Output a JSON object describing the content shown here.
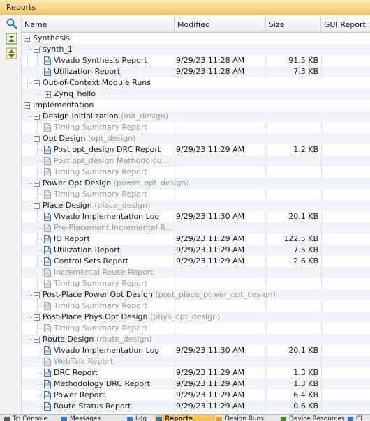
{
  "panel": {
    "title": "Reports"
  },
  "toolbar": {
    "search": "search-icon",
    "collapse_all": "collapse-all-icon",
    "expand_all": "expand-all-icon"
  },
  "columns": {
    "name": "Name",
    "modified": "Modified",
    "size": "Size",
    "gui": "GUI Report"
  },
  "rows": [
    {
      "level": 0,
      "kind": "group",
      "label": "Synthesis"
    },
    {
      "level": 1,
      "kind": "group",
      "label": "synth_1"
    },
    {
      "level": 2,
      "kind": "file",
      "label": "Vivado Synthesis Report",
      "modified": "9/29/23 11:28 AM",
      "size": "91.5 KB"
    },
    {
      "level": 2,
      "kind": "file",
      "label": "Utilization Report",
      "modified": "9/29/23 11:28 AM",
      "size": "7.3 KB"
    },
    {
      "level": 1,
      "kind": "group",
      "label": "Out-of-Context Module Runs"
    },
    {
      "level": 2,
      "kind": "group",
      "collapsed": true,
      "label": "Zynq_hello"
    },
    {
      "level": 0,
      "kind": "group",
      "label": "Implementation"
    },
    {
      "level": 1,
      "kind": "group",
      "label": "Design Initialization",
      "hint": "(init_design)"
    },
    {
      "level": 2,
      "kind": "file",
      "disabled": true,
      "label": "Timing Summary Report"
    },
    {
      "level": 1,
      "kind": "group",
      "label": "Opt Design",
      "hint": "(opt_design)"
    },
    {
      "level": 2,
      "kind": "file",
      "label": "Post opt_design DRC Report",
      "modified": "9/29/23 11:29 AM",
      "size": "1.2 KB"
    },
    {
      "level": 2,
      "kind": "file",
      "disabled": true,
      "label": "Post opt_design Methodolog..."
    },
    {
      "level": 2,
      "kind": "file",
      "disabled": true,
      "label": "Timing Summary Report"
    },
    {
      "level": 1,
      "kind": "group",
      "label": "Power Opt Design",
      "hint": "(power_opt_design)"
    },
    {
      "level": 2,
      "kind": "file",
      "disabled": true,
      "label": "Timing Summary Report"
    },
    {
      "level": 1,
      "kind": "group",
      "label": "Place Design",
      "hint": "(place_design)"
    },
    {
      "level": 2,
      "kind": "file",
      "label": "Vivado Implementation Log",
      "modified": "9/29/23 11:30 AM",
      "size": "20.1 KB"
    },
    {
      "level": 2,
      "kind": "file",
      "disabled": true,
      "label": "Pre-Placement Incremental R..."
    },
    {
      "level": 2,
      "kind": "file",
      "label": "IO Report",
      "modified": "9/29/23 11:29 AM",
      "size": "122.5 KB"
    },
    {
      "level": 2,
      "kind": "file",
      "label": "Utilization Report",
      "modified": "9/29/23 11:29 AM",
      "size": "7.5 KB"
    },
    {
      "level": 2,
      "kind": "file",
      "label": "Control Sets Report",
      "modified": "9/29/23 11:29 AM",
      "size": "2.6 KB"
    },
    {
      "level": 2,
      "kind": "file",
      "disabled": true,
      "label": "Incremental Reuse Report"
    },
    {
      "level": 2,
      "kind": "file",
      "disabled": true,
      "label": "Timing Summary Report"
    },
    {
      "level": 1,
      "kind": "group",
      "label": "Post-Place Power Opt Design",
      "hint": "(post_place_power_opt_design)"
    },
    {
      "level": 2,
      "kind": "file",
      "disabled": true,
      "label": "Timing Summary Report"
    },
    {
      "level": 1,
      "kind": "group",
      "label": "Post-Place Phys Opt Design",
      "hint": "(phys_opt_design)"
    },
    {
      "level": 2,
      "kind": "file",
      "disabled": true,
      "label": "Timing Summary Report"
    },
    {
      "level": 1,
      "kind": "group",
      "label": "Route Design",
      "hint": "(route_design)"
    },
    {
      "level": 2,
      "kind": "file",
      "label": "Vivado Implementation Log",
      "modified": "9/29/23 11:30 AM",
      "size": "20.1 KB"
    },
    {
      "level": 2,
      "kind": "file",
      "disabled": true,
      "label": "WebTalk Report"
    },
    {
      "level": 2,
      "kind": "file",
      "label": "DRC Report",
      "modified": "9/29/23 11:29 AM",
      "size": "1.3 KB"
    },
    {
      "level": 2,
      "kind": "file",
      "label": "Methodology DRC Report",
      "modified": "9/29/23 11:29 AM",
      "size": "1.3 KB"
    },
    {
      "level": 2,
      "kind": "file",
      "label": "Power Report",
      "modified": "9/29/23 11:29 AM",
      "size": "6.4 KB"
    },
    {
      "level": 2,
      "kind": "file",
      "label": "Route Status Report",
      "modified": "9/29/23 11:29 AM",
      "size": "0.6 KB"
    }
  ],
  "bottom_tabs": [
    {
      "label": "Tcl Console",
      "active": false
    },
    {
      "label": "Messages",
      "active": false
    },
    {
      "label": "Log",
      "active": false
    },
    {
      "label": "Reports",
      "active": true
    },
    {
      "label": "Design Runs",
      "active": false
    },
    {
      "label": "Device Resources",
      "active": false
    },
    {
      "label": "Cl",
      "active": false
    }
  ]
}
